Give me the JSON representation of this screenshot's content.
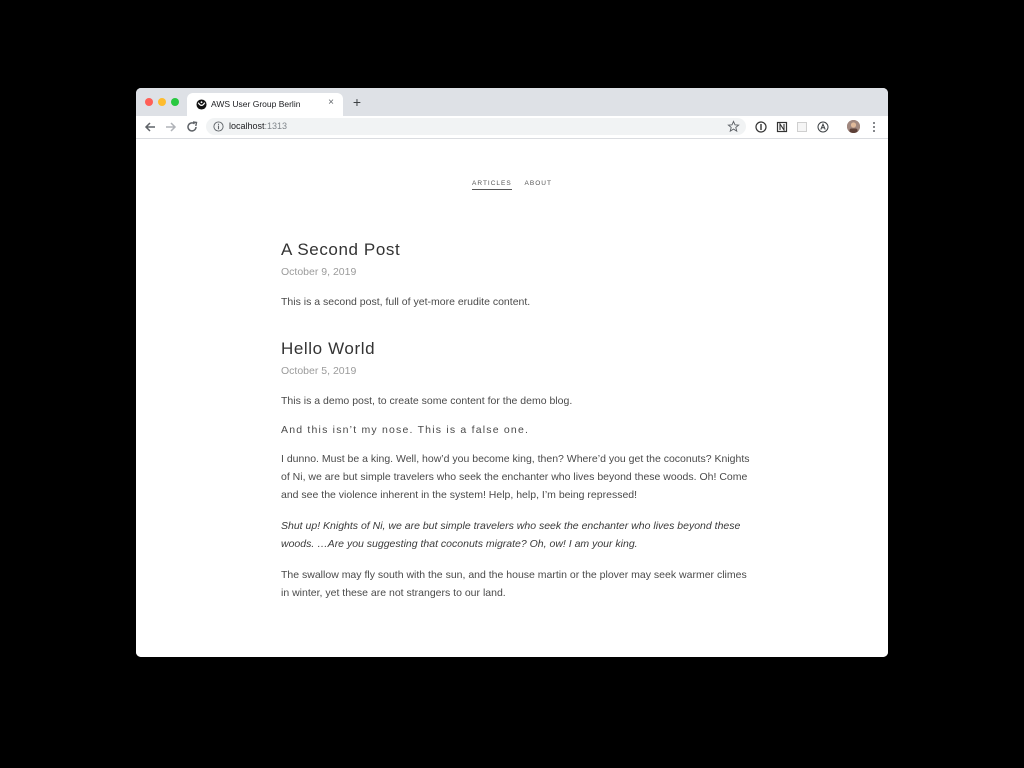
{
  "browser": {
    "tab_title": "AWS User Group Berlin",
    "tab_close": "×",
    "new_tab": "+",
    "url_host": "localhost",
    "url_port": ":1313"
  },
  "nav": {
    "articles": "ARTICLES",
    "about": "ABOUT"
  },
  "posts": [
    {
      "title": "A Second Post",
      "date": "October 9, 2019",
      "paragraphs": [
        "This is a second post, full of yet-more erudite content."
      ]
    },
    {
      "title": "Hello World",
      "date": "October 5, 2019",
      "paragraphs": [
        "This is a demo post, to create some content for the demo blog.",
        "And this isn’t my nose. This is a false one.",
        "I dunno. Must be a king. Well, how’d you become king, then? Where’d you get the coconuts? Knights of Ni, we are but simple travelers who seek the enchanter who lives beyond these woods. Oh! Come and see the violence inherent in the system! Help, help, I’m being repressed!",
        "Shut up! Knights of Ni, we are but simple travelers who seek the enchanter who lives beyond these woods. …Are you suggesting that coconuts migrate? Oh, ow! I am your king.",
        "The swallow may fly south with the sun, and the house martin or the plover may seek warmer climes in winter, yet these are not strangers to our land."
      ]
    }
  ]
}
